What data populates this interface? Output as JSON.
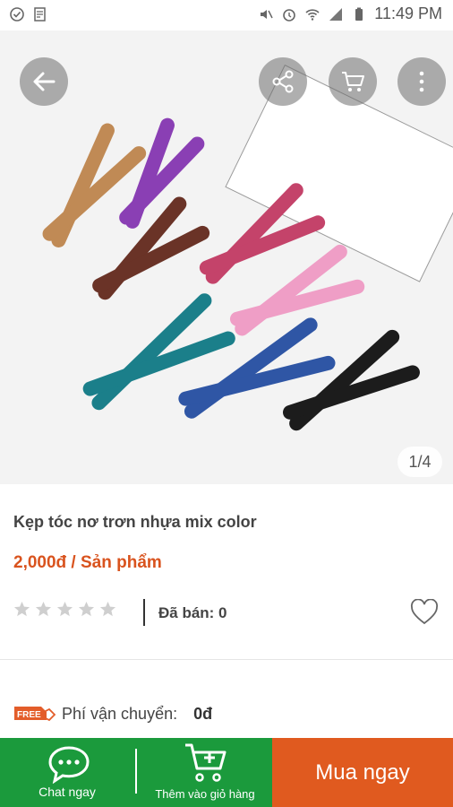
{
  "status_bar": {
    "time": "11:49 PM"
  },
  "gallery": {
    "counter": "1/4"
  },
  "product": {
    "title": "Kẹp tóc nơ trơn nhựa mix color",
    "price": "2,000đ / Sản phẩm",
    "rating": 0,
    "sold": "Đã bán: 0"
  },
  "shipping": {
    "badge": "FREE",
    "label": "Phí vận chuyển:",
    "value": "0đ"
  },
  "actions": {
    "chat": "Chat ngay",
    "add_to_cart": "Thêm vào giỏ hàng",
    "buy": "Mua ngay"
  },
  "colors": {
    "green": "#1b9a3c",
    "orange": "#e05a1f",
    "price": "#d9531e"
  },
  "clips": [
    {
      "name": "tan",
      "color": "#c08a55"
    },
    {
      "name": "purple",
      "color": "#8a3fb4"
    },
    {
      "name": "brown",
      "color": "#6a3327"
    },
    {
      "name": "rose",
      "color": "#c4436a"
    },
    {
      "name": "pink",
      "color": "#ef9ec6"
    },
    {
      "name": "teal",
      "color": "#1b7f8a"
    },
    {
      "name": "blue",
      "color": "#2f56a5"
    },
    {
      "name": "black",
      "color": "#1c1c1c"
    }
  ]
}
